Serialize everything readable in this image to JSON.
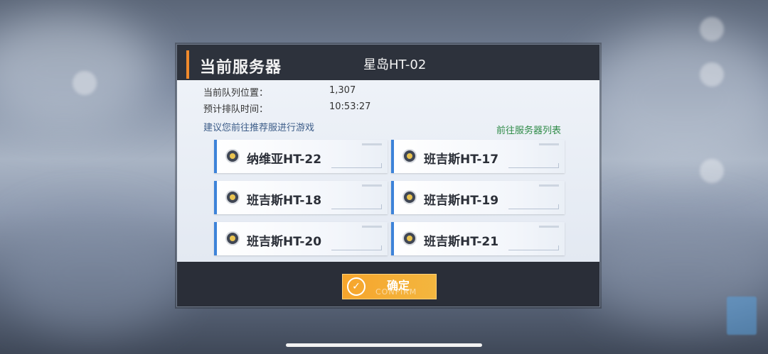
{
  "dialog": {
    "header_title": "当前服务器",
    "current_server": "星岛HT-02",
    "queue_position_label": "当前队列位置：",
    "queue_position_value": "1,307",
    "wait_time_label": "预计排队时间：",
    "wait_time_value": "10:53:27",
    "suggestion_text": "建议您前往推荐服进行游戏",
    "server_list_link": "前往服务器列表",
    "servers": [
      {
        "name": "纳维亚HT-22"
      },
      {
        "name": "班吉斯HT-17"
      },
      {
        "name": "班吉斯HT-18"
      },
      {
        "name": "班吉斯HT-19"
      },
      {
        "name": "班吉斯HT-20"
      },
      {
        "name": "班吉斯HT-21"
      }
    ],
    "confirm_label": "确定",
    "confirm_sub": "CONFIRM"
  },
  "colors": {
    "accent": "#f08a2c",
    "card_border": "#3d83d9",
    "link": "#2e8b47",
    "confirm": "#f6a52c"
  },
  "icons": [
    "server-status-icon",
    "check-icon"
  ]
}
